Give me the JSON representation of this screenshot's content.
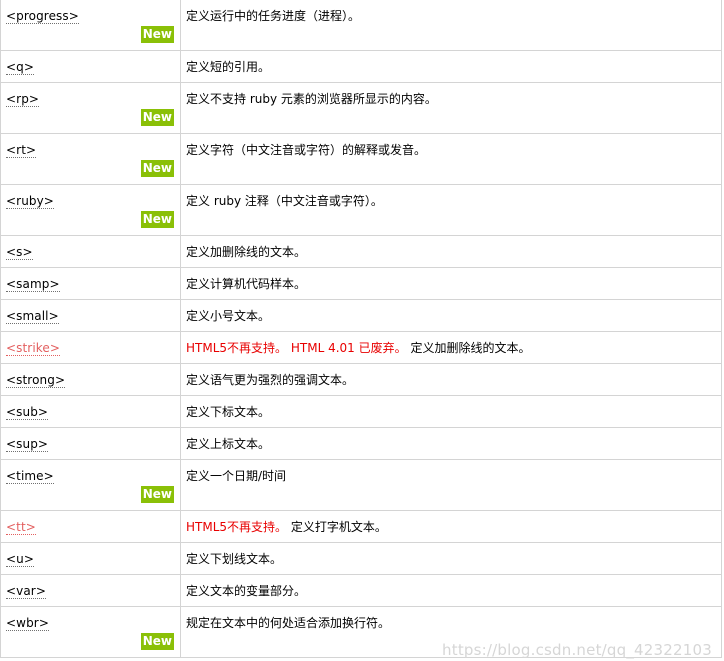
{
  "badge_label": "New",
  "rows": [
    {
      "tag": "<progress>",
      "desc": "定义运行中的任务进度（进程）。",
      "new": true
    },
    {
      "tag": "<q>",
      "desc": "定义短的引用。"
    },
    {
      "tag": "<rp>",
      "desc": "定义不支持 ruby 元素的浏览器所显示的内容。",
      "new": true
    },
    {
      "tag": "<rt>",
      "desc": "定义字符（中文注音或字符）的解释或发音。",
      "new": true
    },
    {
      "tag": "<ruby>",
      "desc": "定义 ruby 注释（中文注音或字符）。",
      "new": true
    },
    {
      "tag": "<s>",
      "desc": "定义加删除线的文本。"
    },
    {
      "tag": "<samp>",
      "desc": "定义计算机代码样本。"
    },
    {
      "tag": "<small>",
      "desc": "定义小号文本。"
    },
    {
      "tag": "<strike>",
      "deprecated": true,
      "warn": [
        "HTML5不再支持。",
        "HTML 4.01 已废弃。"
      ],
      "desc": "定义加删除线的文本。"
    },
    {
      "tag": "<strong>",
      "desc": "定义语气更为强烈的强调文本。"
    },
    {
      "tag": "<sub>",
      "desc": "定义下标文本。"
    },
    {
      "tag": "<sup>",
      "desc": "定义上标文本。"
    },
    {
      "tag": "<time>",
      "desc": "定义一个日期/时间",
      "new": true
    },
    {
      "tag": "<tt>",
      "deprecated": true,
      "warn": [
        "HTML5不再支持。"
      ],
      "desc": "定义打字机文本。"
    },
    {
      "tag": "<u>",
      "desc": "定义下划线文本。"
    },
    {
      "tag": "<var>",
      "desc": "定义文本的变量部分。"
    },
    {
      "tag": "<wbr>",
      "desc": "规定在文本中的何处适合添加换行符。",
      "new": true
    }
  ],
  "watermark": "https://blog.csdn.net/qq_42322103",
  "colors": {
    "new_badge": "#8ac007",
    "deprecated_link": "#e35f5f",
    "warning_text": "#e80000",
    "border": "#d4d4d4"
  }
}
